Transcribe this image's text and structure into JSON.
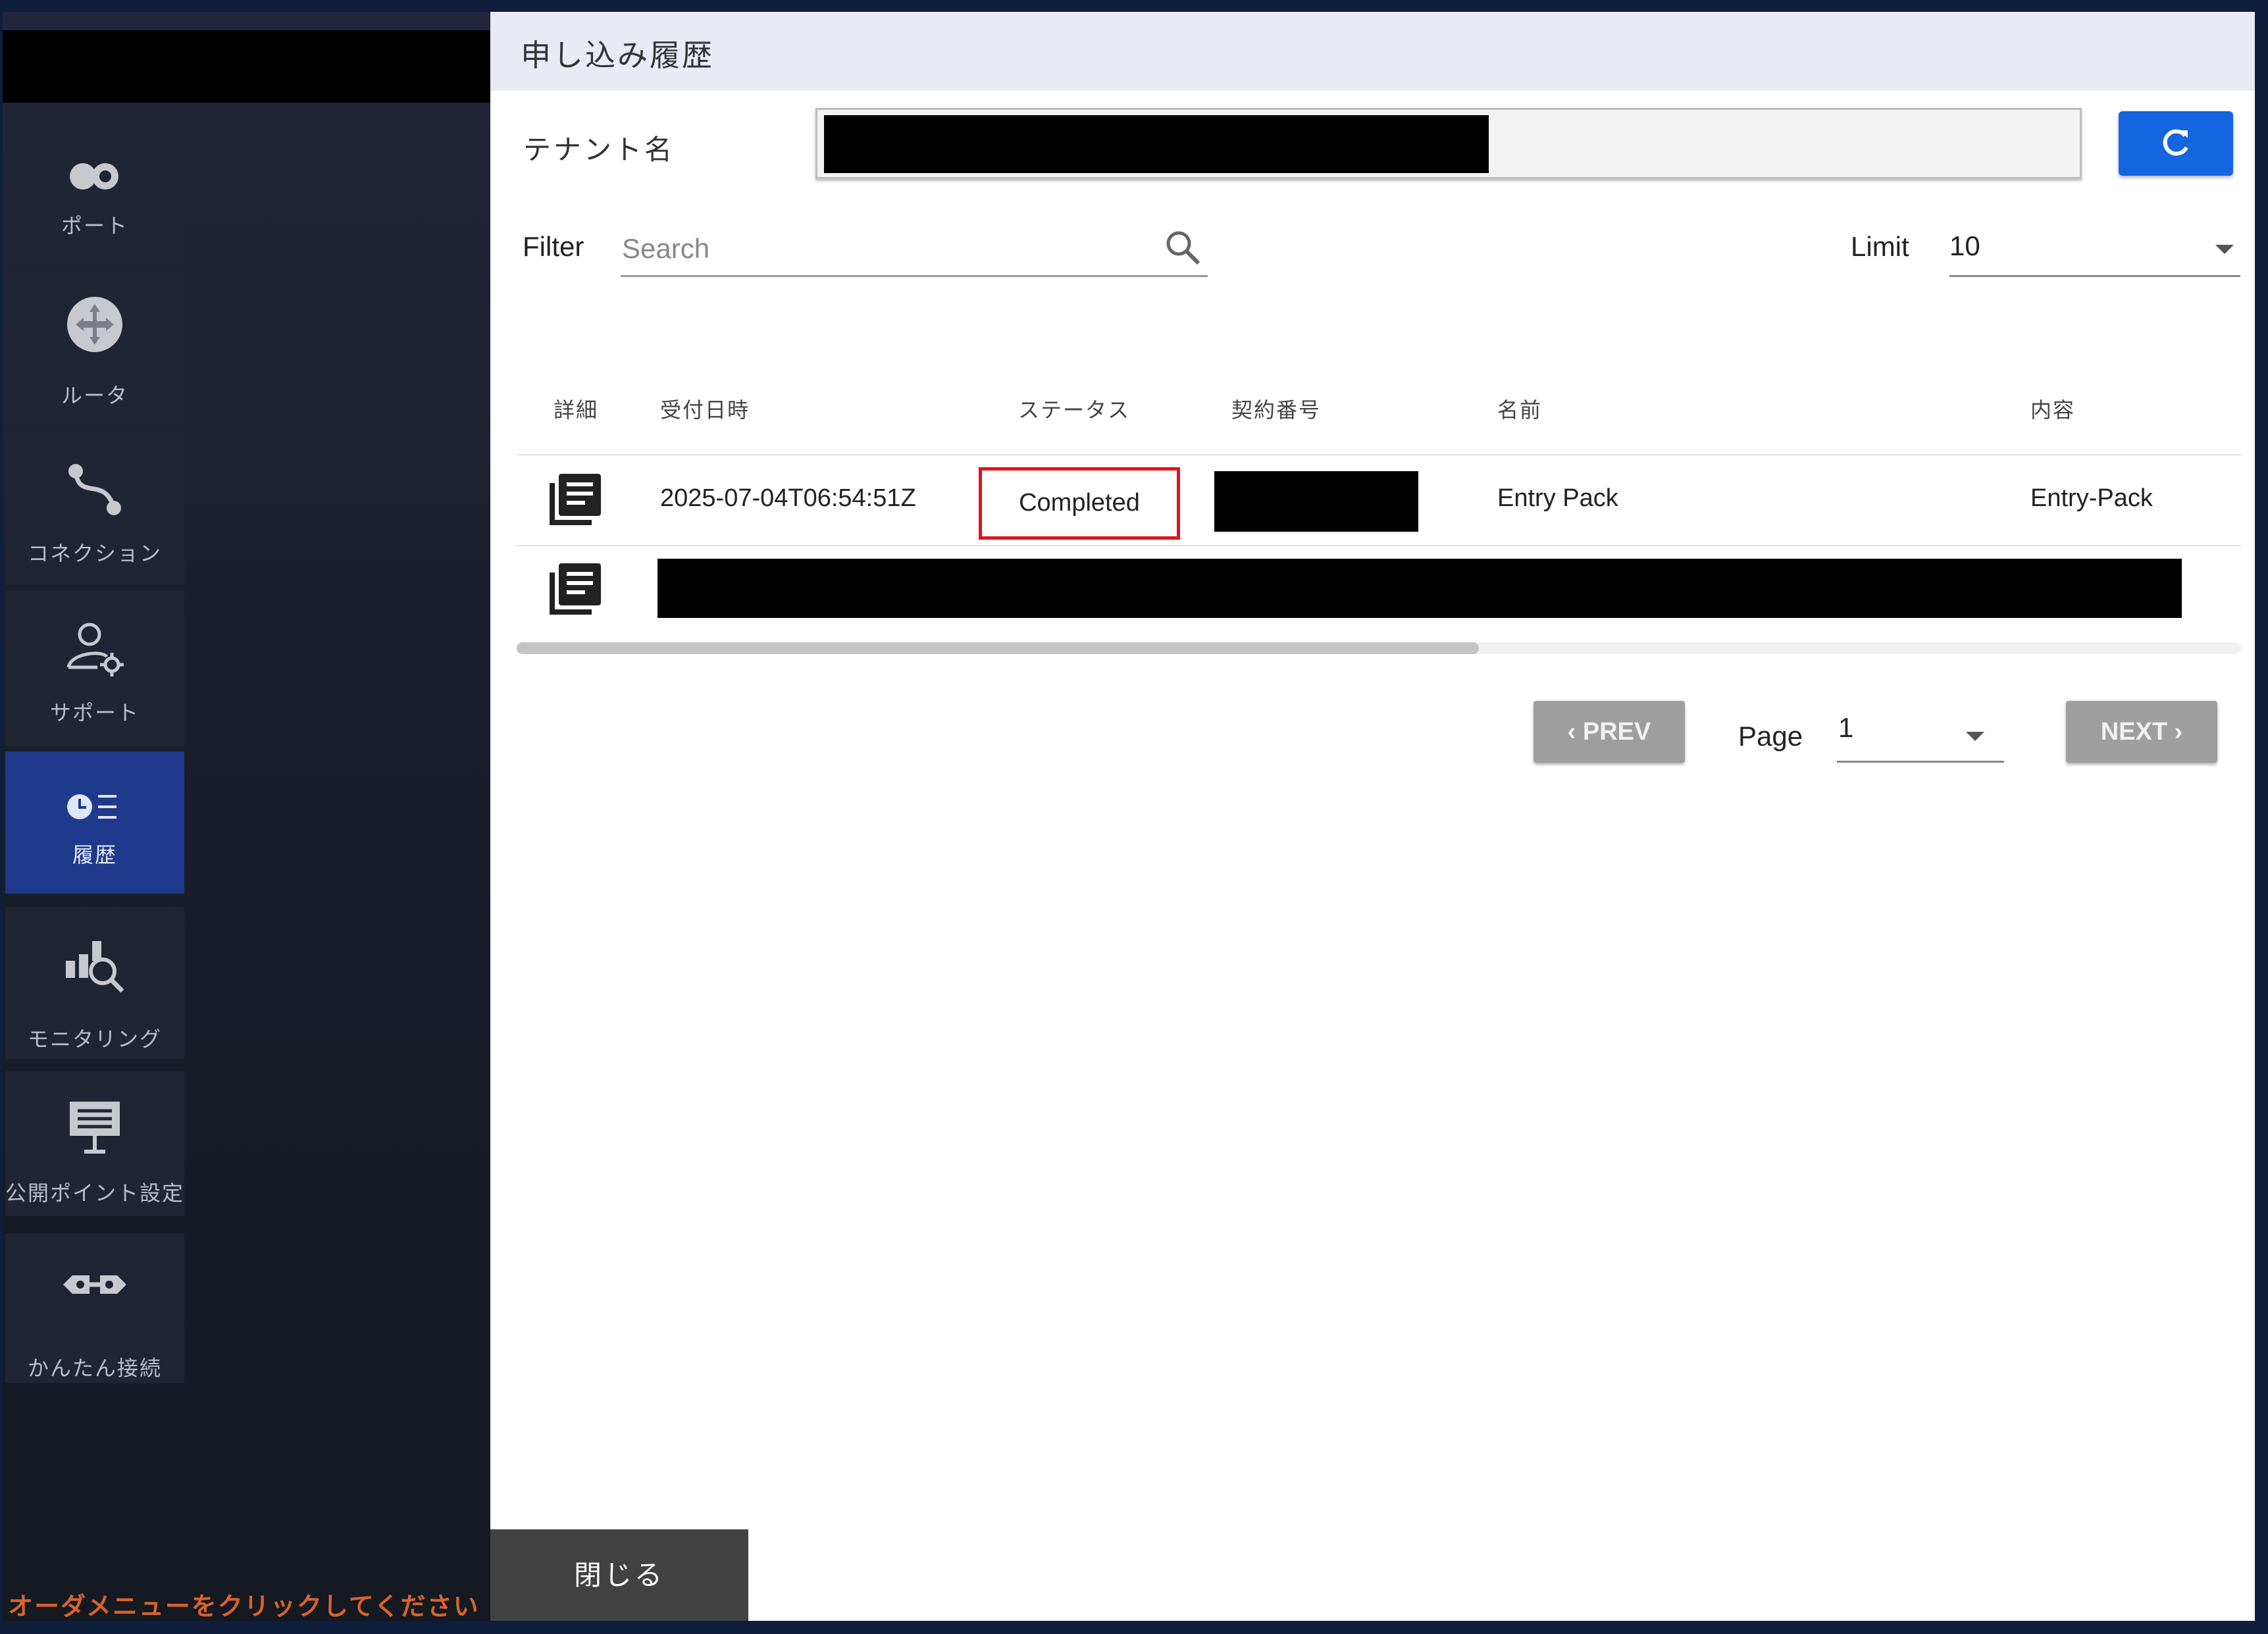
{
  "sidebar": {
    "items": [
      {
        "label": "ポート",
        "icon": "port-icon"
      },
      {
        "label": "ルータ",
        "icon": "router-icon"
      },
      {
        "label": "コネクション",
        "icon": "connection-icon"
      },
      {
        "label": "サポート",
        "icon": "support-icon"
      },
      {
        "label": "履歴",
        "icon": "history-icon",
        "active": true
      },
      {
        "label": "モニタリング",
        "icon": "monitoring-icon"
      },
      {
        "label": "公開ポイント設定",
        "icon": "public-point-icon"
      },
      {
        "label": "かんたん接続",
        "icon": "easy-connect-icon"
      }
    ],
    "hint": "オーダメニューをクリックしてください"
  },
  "dialog": {
    "title": "申し込み履歴",
    "tenant_label": "テナント名",
    "filter_label": "Filter",
    "search_placeholder": "Search",
    "limit_label": "Limit",
    "limit_value": "10",
    "table": {
      "headers": [
        "詳細",
        "受付日時",
        "ステータス",
        "契約番号",
        "名前",
        "内容"
      ],
      "rows": [
        {
          "received": "2025-07-04T06:54:51Z",
          "status": "Completed",
          "name": "Entry Pack",
          "content": "Entry-Pack"
        }
      ]
    },
    "pagination": {
      "prev_label": "PREV",
      "next_label": "NEXT",
      "page_label": "Page",
      "page_value": "1"
    },
    "close_label": "閉じる"
  },
  "colors": {
    "accent": "#1565e0",
    "active_nav": "#1f3a8c",
    "highlight_border": "#e0141e",
    "hint_text": "#d9632a"
  }
}
